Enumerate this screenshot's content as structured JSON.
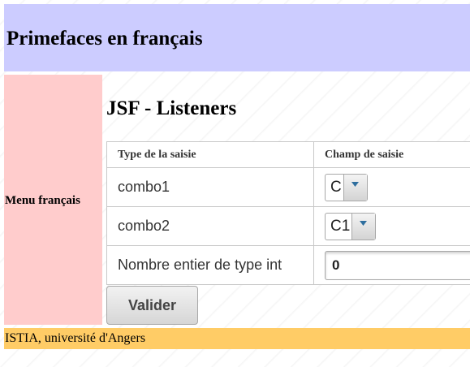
{
  "header": {
    "title": "Primefaces en français"
  },
  "menu": {
    "label": "Menu français"
  },
  "content": {
    "title": "JSF - Listeners",
    "table": {
      "headers": [
        "Type de la saisie",
        "Champ de saisie"
      ],
      "rows": [
        {
          "label": "combo1",
          "value": "C"
        },
        {
          "label": "combo2",
          "value": "C1"
        },
        {
          "label": "Nombre entier de type int",
          "value": "0"
        }
      ]
    },
    "submit_label": "Valider"
  },
  "footer": {
    "text": "ISTIA, université d'Angers"
  },
  "colors": {
    "header_bg": "#ccccff",
    "menu_bg": "#ffcccc",
    "footer_bg": "#ffcc66"
  },
  "icons": {
    "dropdown": "triangle-down-icon"
  }
}
